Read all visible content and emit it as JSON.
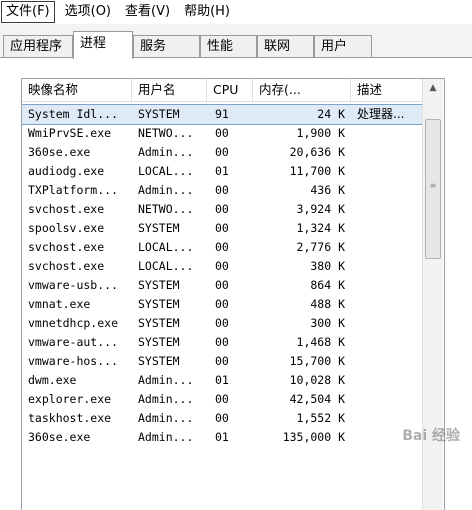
{
  "menu": [
    {
      "label": "文件(F)"
    },
    {
      "label": "选项(O)"
    },
    {
      "label": "查看(V)"
    },
    {
      "label": "帮助(H)"
    }
  ],
  "tabs": [
    {
      "label": "应用程序"
    },
    {
      "label": "进程"
    },
    {
      "label": "服务"
    },
    {
      "label": "性能"
    },
    {
      "label": "联网"
    },
    {
      "label": "用户"
    }
  ],
  "columns": {
    "name": "映像名称",
    "user": "用户名",
    "cpu": "CPU",
    "mem": "内存(...",
    "desc": "描述"
  },
  "processes": [
    {
      "name": "System Idl...",
      "user": "SYSTEM",
      "cpu": "91",
      "mem": "24 K",
      "desc": "处理器..."
    },
    {
      "name": "WmiPrvSE.exe",
      "user": "NETWO...",
      "cpu": "00",
      "mem": "1,900 K",
      "desc": ""
    },
    {
      "name": "360se.exe",
      "user": "Admin...",
      "cpu": "00",
      "mem": "20,636 K",
      "desc": ""
    },
    {
      "name": "audiodg.exe",
      "user": "LOCAL...",
      "cpu": "01",
      "mem": "11,700 K",
      "desc": ""
    },
    {
      "name": "TXPlatform...",
      "user": "Admin...",
      "cpu": "00",
      "mem": "436 K",
      "desc": ""
    },
    {
      "name": "svchost.exe",
      "user": "NETWO...",
      "cpu": "00",
      "mem": "3,924 K",
      "desc": ""
    },
    {
      "name": "spoolsv.exe",
      "user": "SYSTEM",
      "cpu": "00",
      "mem": "1,324 K",
      "desc": ""
    },
    {
      "name": "svchost.exe",
      "user": "LOCAL...",
      "cpu": "00",
      "mem": "2,776 K",
      "desc": ""
    },
    {
      "name": "svchost.exe",
      "user": "LOCAL...",
      "cpu": "00",
      "mem": "380 K",
      "desc": ""
    },
    {
      "name": "vmware-usb...",
      "user": "SYSTEM",
      "cpu": "00",
      "mem": "864 K",
      "desc": ""
    },
    {
      "name": "vmnat.exe",
      "user": "SYSTEM",
      "cpu": "00",
      "mem": "488 K",
      "desc": ""
    },
    {
      "name": "vmnetdhcp.exe",
      "user": "SYSTEM",
      "cpu": "00",
      "mem": "300 K",
      "desc": ""
    },
    {
      "name": "vmware-aut...",
      "user": "SYSTEM",
      "cpu": "00",
      "mem": "1,468 K",
      "desc": ""
    },
    {
      "name": "vmware-hos...",
      "user": "SYSTEM",
      "cpu": "00",
      "mem": "15,700 K",
      "desc": ""
    },
    {
      "name": "dwm.exe",
      "user": "Admin...",
      "cpu": "01",
      "mem": "10,028 K",
      "desc": ""
    },
    {
      "name": "explorer.exe",
      "user": "Admin...",
      "cpu": "00",
      "mem": "42,504 K",
      "desc": ""
    },
    {
      "name": "taskhost.exe",
      "user": "Admin...",
      "cpu": "00",
      "mem": "1,552 K",
      "desc": ""
    },
    {
      "name": "360se.exe",
      "user": "Admin...",
      "cpu": "01",
      "mem": "135,000 K",
      "desc": ""
    }
  ],
  "scrollbar": {
    "up_icon": "▲",
    "down_icon": "▼",
    "grip": "≡"
  },
  "watermark": "Bai 经验",
  "colors": {
    "selected_row": "#dfeaf7",
    "border": "#9ba0a6"
  }
}
